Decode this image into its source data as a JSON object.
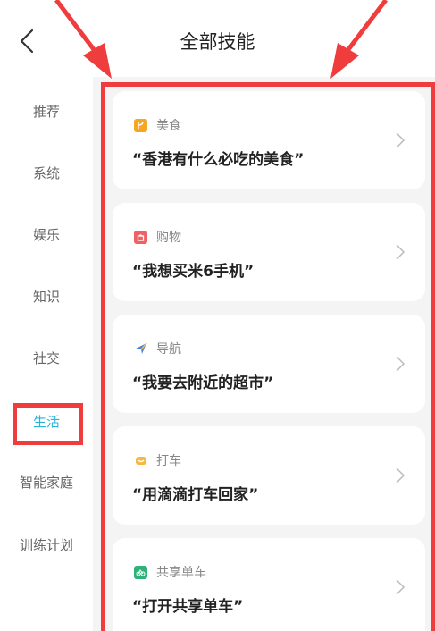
{
  "header": {
    "title": "全部技能",
    "back_icon": "back-chevron-icon"
  },
  "sidebar": {
    "items": [
      {
        "label": "推荐"
      },
      {
        "label": "系统"
      },
      {
        "label": "娱乐"
      },
      {
        "label": "知识"
      },
      {
        "label": "社交"
      },
      {
        "label": "生活"
      },
      {
        "label": "智能家庭"
      },
      {
        "label": "训练计划"
      }
    ],
    "active_index": 5,
    "active_color": "#2bb3d9"
  },
  "cards": [
    {
      "category": "美食",
      "icon": "food-icon",
      "icon_color": "#f5a623",
      "phrase": "“香港有什么必吃的美食”"
    },
    {
      "category": "购物",
      "icon": "shopping-bag-icon",
      "icon_color": "#f06262",
      "phrase": "“我想买米6手机”"
    },
    {
      "category": "导航",
      "icon": "navigation-plane-icon",
      "icon_color": "#4a7fe0",
      "phrase": "“我要去附近的超市”"
    },
    {
      "category": "打车",
      "icon": "taxi-icon",
      "icon_color": "#f5b942",
      "phrase": "“用滴滴打车回家”"
    },
    {
      "category": "共享单车",
      "icon": "bike-icon",
      "icon_color": "#2db37a",
      "phrase": "“打开共享单车”"
    }
  ],
  "annotation_color": "#ef3c3c"
}
